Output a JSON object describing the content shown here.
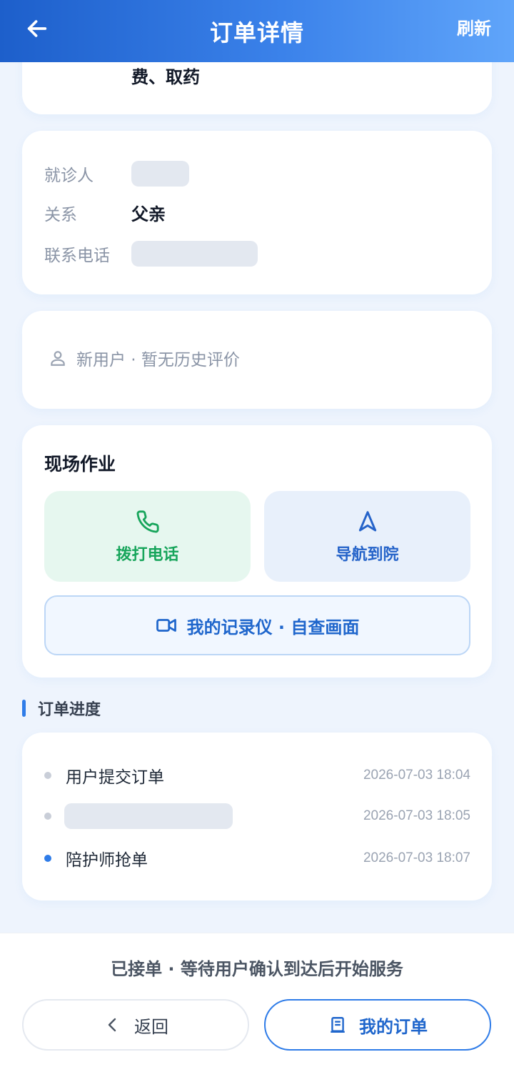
{
  "header": {
    "title": "订单详情",
    "refresh_label": "刷新",
    "back_icon": "arrow-left-icon"
  },
  "service": {
    "text": "费、取药"
  },
  "patient": {
    "patient_label": "就诊人",
    "relation_label": "关系",
    "relation_value": "父亲",
    "phone_label": "联系电话"
  },
  "review": {
    "icon": "user-icon",
    "text": "新用户 · 暂无历史评价"
  },
  "onsite": {
    "title": "现场作业",
    "call_label": "拨打电话",
    "call_icon": "phone-icon",
    "nav_label": "导航到院",
    "nav_icon": "navigation-icon",
    "recorder_label": "我的记录仪 · 自查画面",
    "recorder_icon": "video-camera-icon"
  },
  "progress": {
    "title": "订单进度",
    "items": [
      {
        "label": "用户提交订单",
        "time": "2026-07-03 18:04",
        "active": false
      },
      {
        "label": "",
        "time": "2026-07-03 18:05",
        "active": false
      },
      {
        "label": "陪护师抢单",
        "time": "2026-07-03 18:07",
        "active": true
      }
    ]
  },
  "bottom": {
    "status": "已接单 · 等待用户确认到达后开始服务",
    "back_label": "返回",
    "orders_label": "我的订单",
    "orders_icon": "receipt-icon"
  },
  "colors": {
    "primary": "#2f7ce8",
    "call_green": "#17a55b",
    "header_start": "#1d5fcb",
    "header_end": "#60a5fa"
  }
}
